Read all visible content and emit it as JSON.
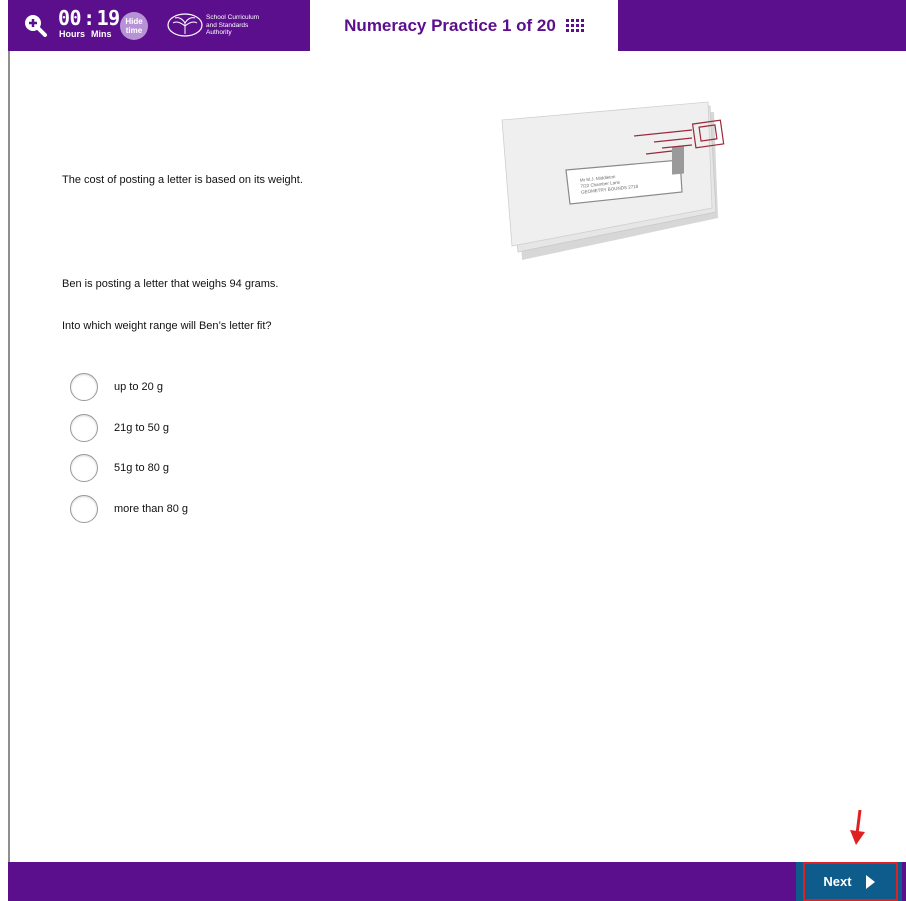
{
  "header": {
    "timer": {
      "hours": "00",
      "mins": "19",
      "hours_label": "Hours",
      "mins_label": "Mins"
    },
    "hide_time_label": "Hide time",
    "authority_lines": [
      "School Curriculum",
      "and Standards",
      "Authority"
    ],
    "title": "Numeracy Practice 1 of 20",
    "icons": {
      "zoom": "zoom-in-icon",
      "grid": "question-grid-icon",
      "logo": "scsa-logo-icon"
    }
  },
  "question": {
    "intro": "The cost of posting a letter is based on its weight.",
    "envelope_address": [
      "Mr M.J. Middleton",
      "7/22 Chamber Lane",
      "GEOMETRY BOUNDS 2718"
    ],
    "statement": "Ben is posting a letter that weighs 94 grams.",
    "prompt": "Into which weight range will Ben’s letter fit?",
    "options": [
      "up to 20 g",
      "21g to 50 g",
      "51g to 80 g",
      "more than 80 g"
    ]
  },
  "footer": {
    "next_label": "Next"
  },
  "colors": {
    "brand_purple": "#5b0f8c",
    "next_button": "#0d5c8c",
    "annotation_red": "#e02020",
    "hide_time_circle": "#b793d6"
  }
}
